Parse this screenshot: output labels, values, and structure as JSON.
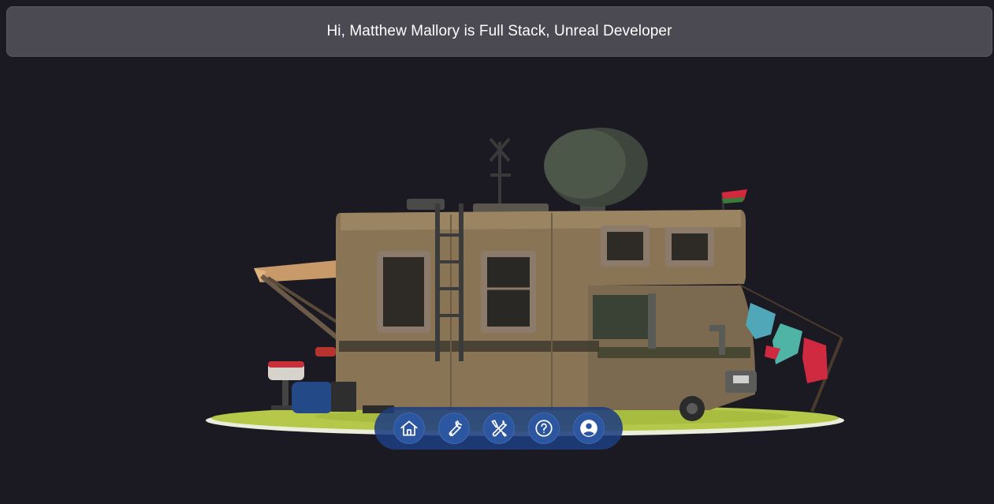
{
  "banner": {
    "text": "Hi, Matthew Mallory is Full Stack, Unreal Developer"
  },
  "scene": {
    "subject": "camper-van-3d-model"
  },
  "dock": {
    "buttons": [
      {
        "icon": "home-icon"
      },
      {
        "icon": "wrench-icon"
      },
      {
        "icon": "tools-icon"
      },
      {
        "icon": "help-icon"
      },
      {
        "icon": "user-icon"
      }
    ]
  },
  "colors": {
    "background": "#1b1a22",
    "banner": "#4b4a52",
    "dock": "#1e3e80",
    "dock_button": "#2d56a0"
  }
}
